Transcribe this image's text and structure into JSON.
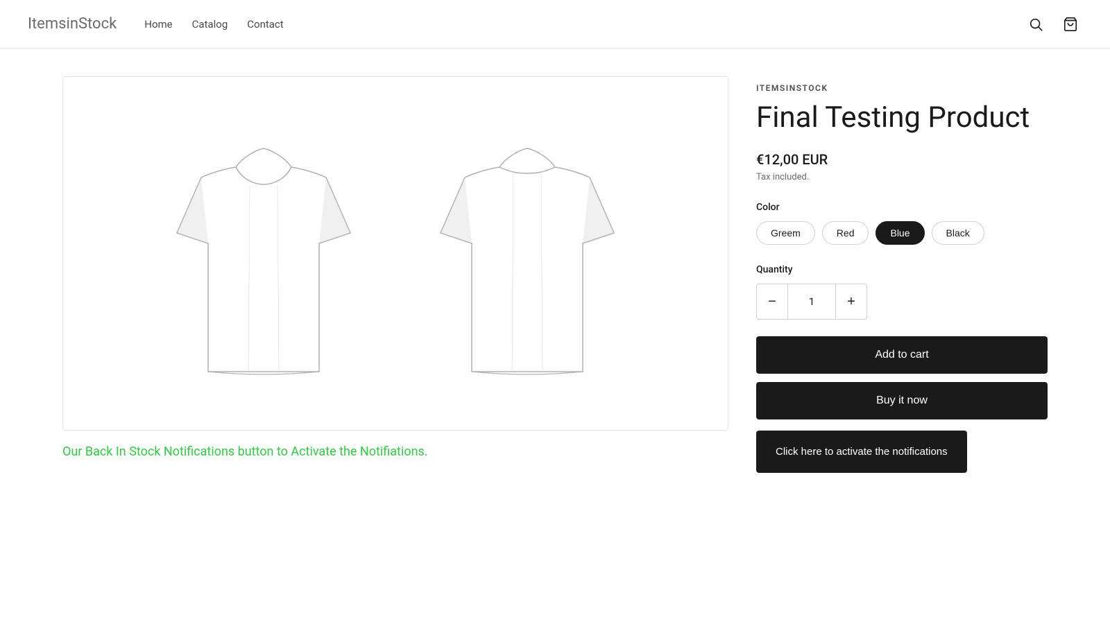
{
  "header": {
    "logo": "ItemsinStock",
    "nav": [
      {
        "label": "Home",
        "href": "#"
      },
      {
        "label": "Catalog",
        "href": "#"
      },
      {
        "label": "Contact",
        "href": "#"
      }
    ]
  },
  "product": {
    "brand": "ITEMSINSTOCK",
    "title": "Final Testing Product",
    "price": "€12,00 EUR",
    "tax_note": "Tax included.",
    "color_label": "Color",
    "colors": [
      {
        "label": "Greem",
        "active": false
      },
      {
        "label": "Red",
        "active": false
      },
      {
        "label": "Blue",
        "active": true
      },
      {
        "label": "Black",
        "active": false
      }
    ],
    "quantity_label": "Quantity",
    "quantity_value": "1",
    "btn_add_cart": "Add to cart",
    "btn_buy_now": "Buy it now",
    "btn_notify": "Click here to activate the notifications",
    "notification_text": "Our Back In Stock Notifications button to Activate the Notifiations."
  }
}
